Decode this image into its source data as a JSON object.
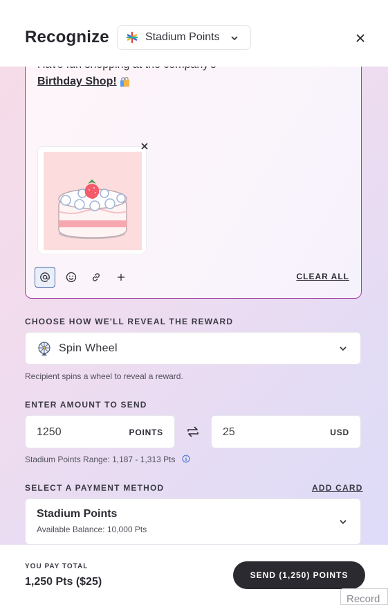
{
  "header": {
    "title": "Recognize",
    "program": "Stadium Points"
  },
  "composer": {
    "message_line1": "Have fun shopping at the company's",
    "message_link": "Birthday Shop!",
    "attachment_image": "birthday cake",
    "clear_all_label": "CLEAR ALL",
    "tools": [
      "mention-icon",
      "emoji-icon",
      "link-icon",
      "plus-icon"
    ]
  },
  "reveal": {
    "label": "CHOOSE HOW WE'LL REVEAL THE REWARD",
    "selected": "Spin Wheel",
    "helper": "Recipient spins a wheel to reveal a reward."
  },
  "amount": {
    "label": "ENTER AMOUNT TO SEND",
    "points_value": "1250",
    "points_unit": "POINTS",
    "usd_value": "25",
    "usd_unit": "USD",
    "range": "Stadium Points Range: 1,187 - 1,313 Pts"
  },
  "payment": {
    "label": "SELECT A PAYMENT METHOD",
    "add_card_label": "ADD CARD",
    "method_name": "Stadium Points",
    "balance": "Available Balance: 10,000 Pts"
  },
  "footer": {
    "total_label": "YOU PAY TOTAL",
    "total_value": "1,250 Pts ($25)",
    "send_label": "SEND (1,250) POINTS",
    "record_label": "Record"
  },
  "colors": {
    "accent_border": "#a63aa0",
    "button_dark": "#2a2a30",
    "info_blue": "#3b6fd6"
  }
}
